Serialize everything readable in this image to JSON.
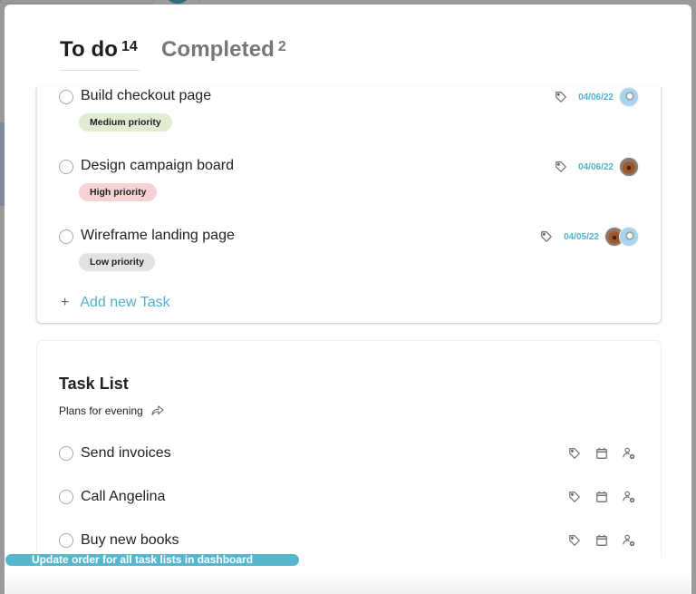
{
  "tabs": [
    {
      "label": "To do",
      "count": "14",
      "active": true
    },
    {
      "label": "Completed",
      "count": "2",
      "active": false
    }
  ],
  "todo_tasks": [
    {
      "title": "Build checkout page",
      "priority": "Medium priority",
      "priority_level": "medium",
      "date": "04/06/22",
      "assignees": [
        "cat-avatar"
      ]
    },
    {
      "title": "Design campaign board",
      "priority": "High priority",
      "priority_level": "high",
      "date": "04/06/22",
      "assignees": [
        "dog-avatar"
      ]
    },
    {
      "title": "Wireframe landing page",
      "priority": "Low priority",
      "priority_level": "low",
      "date": "04/05/22",
      "assignees": [
        "dog-avatar",
        "cat-avatar"
      ]
    }
  ],
  "add_task": {
    "icon": "+",
    "label": "Add new Task"
  },
  "task_list": {
    "title": "Task List",
    "subtitle": "Plans for evening",
    "items": [
      {
        "title": "Send invoices"
      },
      {
        "title": "Call Angelina"
      },
      {
        "title": "Buy new books"
      }
    ]
  },
  "toast": {
    "text": "Update order for all task lists in dashboard"
  },
  "colors": {
    "accent": "#4fb2c9",
    "toast_bg": "#56b6cd",
    "medium_priority": "#e2ecd3",
    "high_priority": "#f6d2d5",
    "low_priority": "#e3e3e3"
  }
}
